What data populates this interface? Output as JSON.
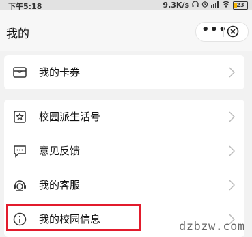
{
  "status_bar": {
    "time": "下午5:18",
    "net_speed": "9.3K/s",
    "battery": "23",
    "battery_level": 0.23
  },
  "header": {
    "title": "我的",
    "more_label": "•••"
  },
  "groups": [
    {
      "items": [
        {
          "label": "我的卡券",
          "icon": "wallet-icon"
        }
      ]
    },
    {
      "items": [
        {
          "label": "校园派生活号",
          "icon": "star-badge-icon"
        },
        {
          "label": "意见反馈",
          "icon": "chat-bubble-icon"
        },
        {
          "label": "我的客服",
          "icon": "headset-icon"
        },
        {
          "label": "我的校园信息",
          "icon": "info-icon"
        }
      ]
    }
  ],
  "watermark": "dzbzw.com",
  "colors": {
    "highlight": "#e21b2c",
    "background": "#f2f2f2"
  }
}
